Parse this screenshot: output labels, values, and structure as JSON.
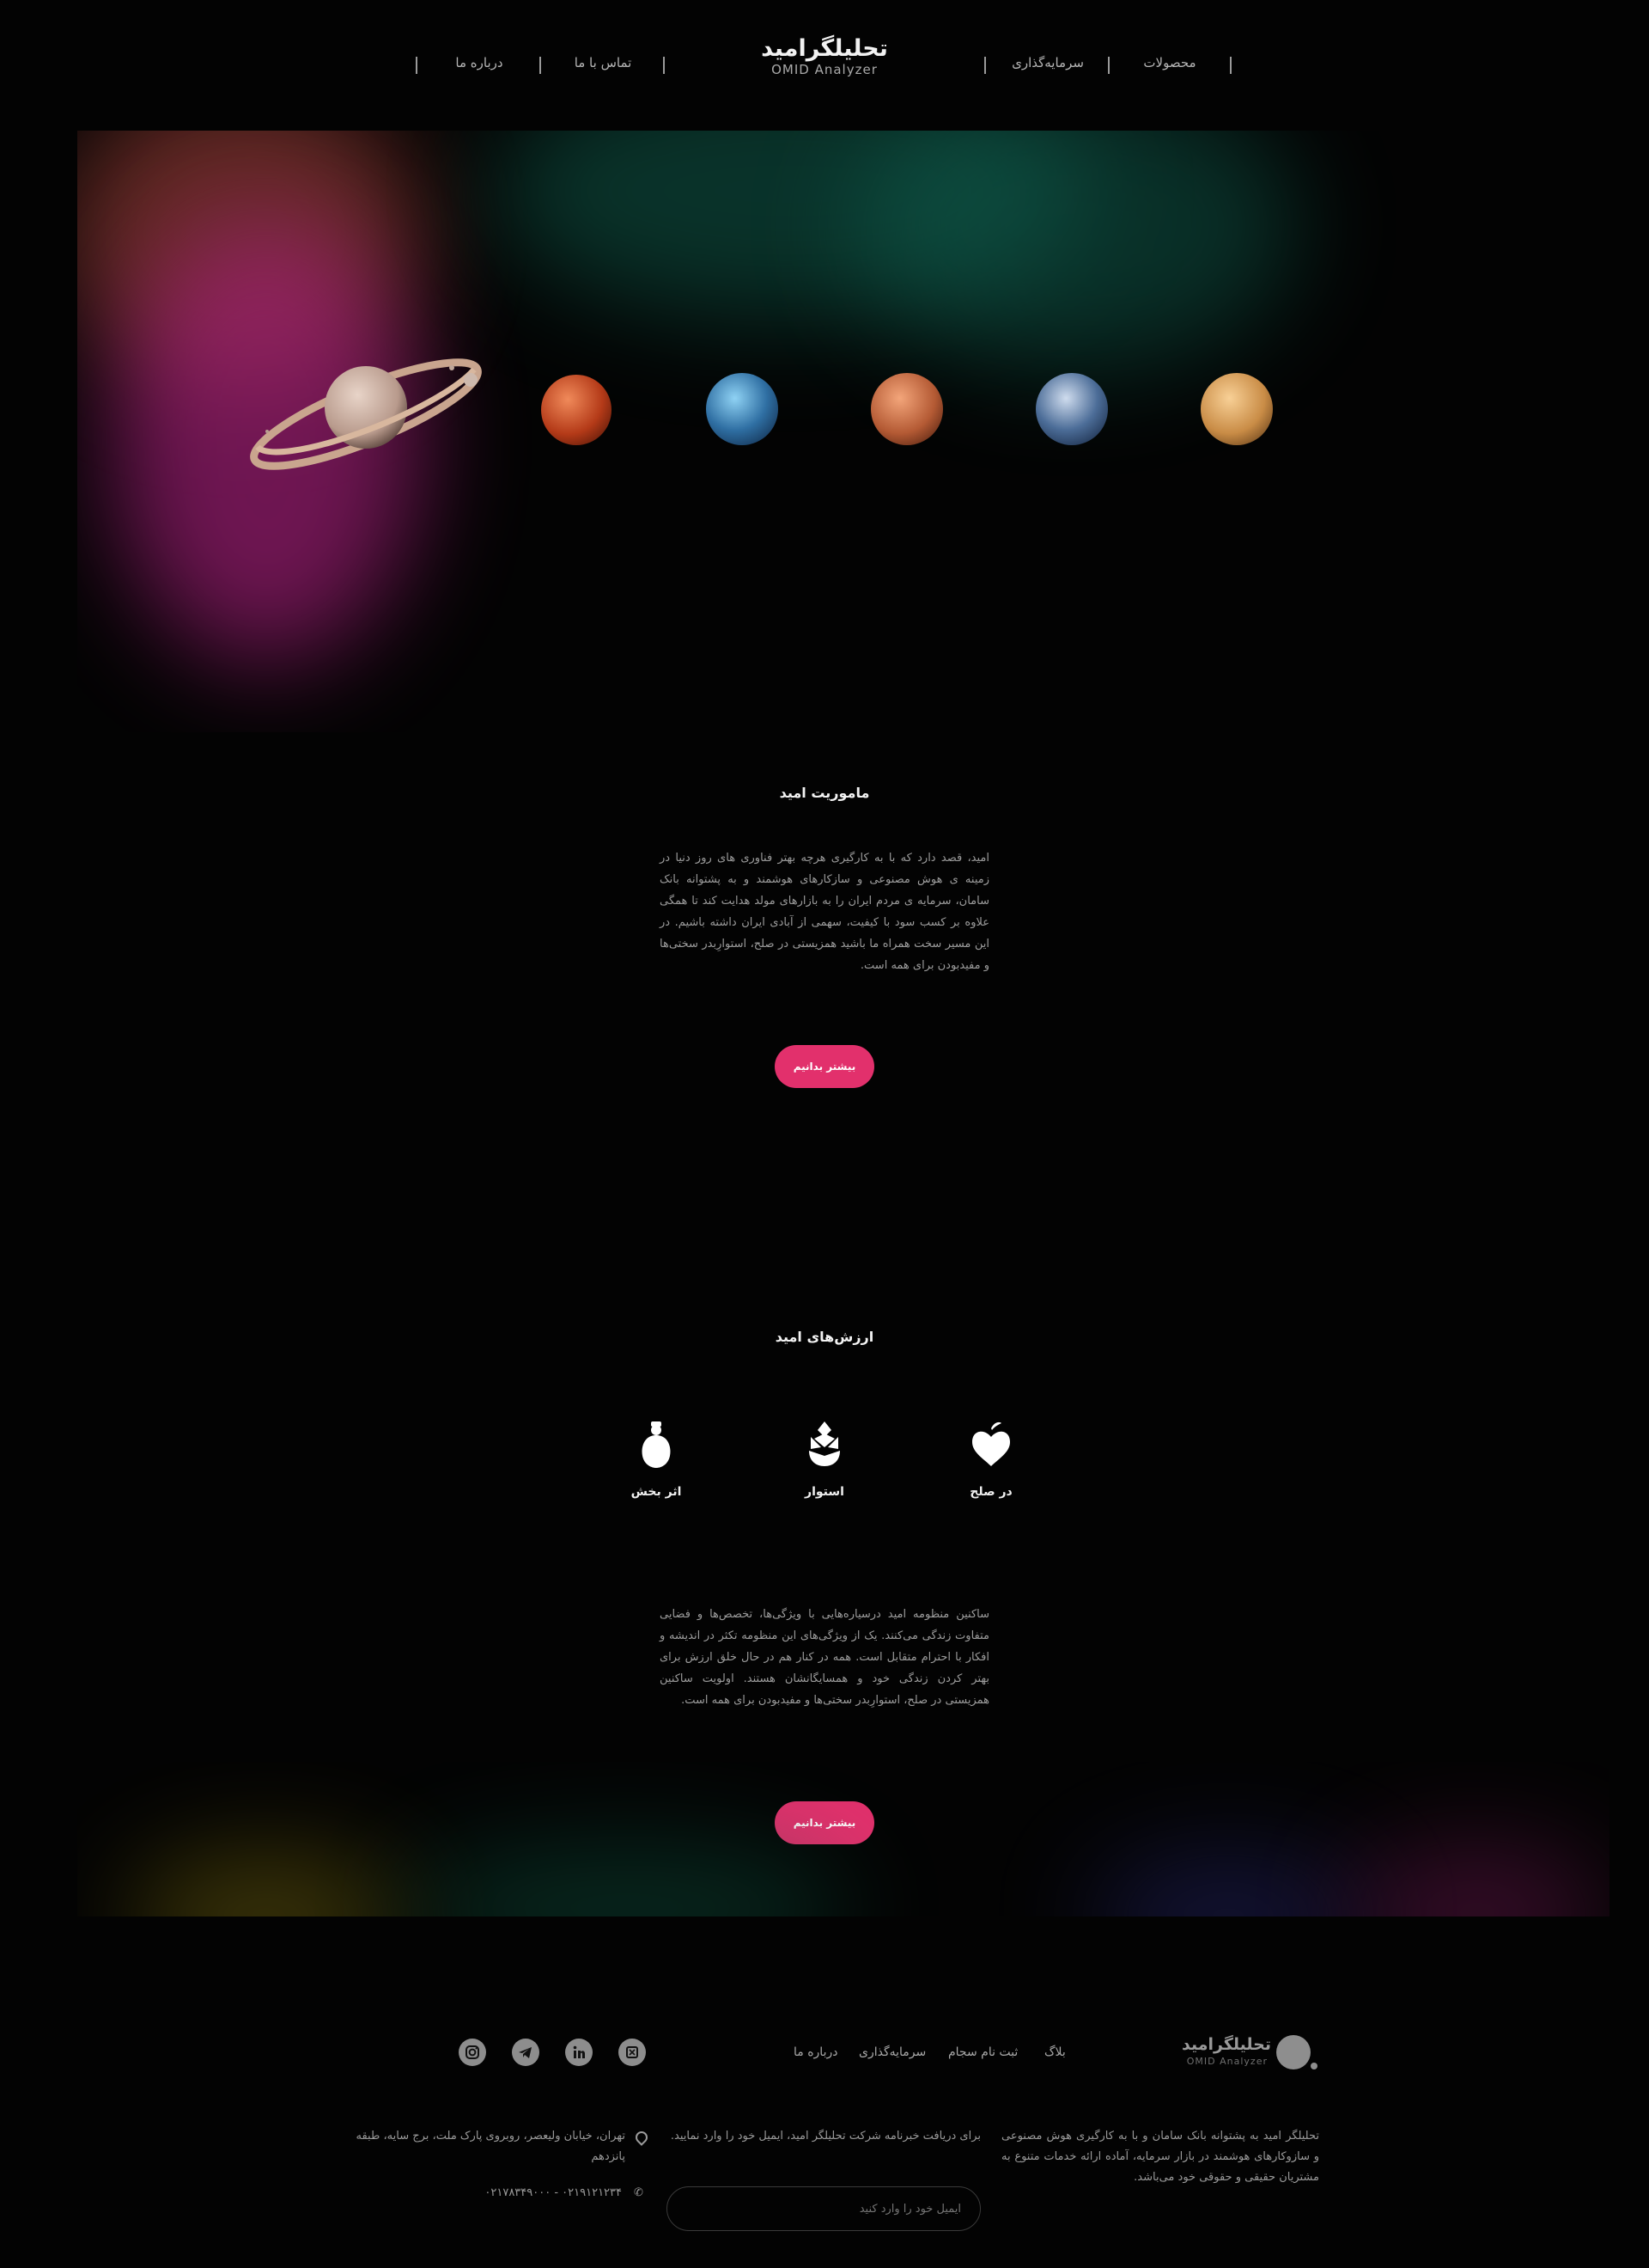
{
  "header": {
    "logo_fa": "تحلیلگرامید",
    "logo_en": "OMID Analyzer",
    "nav_right": [
      "محصولات",
      "سرمایه‌گذاری"
    ],
    "nav_left": [
      "تماس با ما",
      "درباره ما"
    ]
  },
  "mission": {
    "title": "ماموریت امید",
    "body": "امید، قصد دارد که با به کارگیری هرچه بهتر فناوری های روز دنیا در زمینه ی هوش مصنوعی و سازکارهای هوشمند و به پشتوانه بانک سامان، سرمایه ی مردم ایران را به بازارهای مولد هدایت کند تا همگی علاوه بر کسب سود با کیفیت، سهمی از آبادی ایران داشته باشیم. در این مسیر سخت همراه ما باشید همزیستی در صلح، استوارِبدر سختی‌ها و مفیدبودن برای همه است.",
    "cta": "بیشتر بدانیم"
  },
  "values": {
    "title": "ارزش‌های امید",
    "items": [
      {
        "label": "در صلح",
        "icon": "apple-heart-icon"
      },
      {
        "label": "استوار",
        "icon": "pinecone-icon"
      },
      {
        "label": "اثر بخش",
        "icon": "seed-icon"
      }
    ],
    "body": "ساکنین منظومه امید درسیاره‌هایی با ویژگی‌ها، تخصص‌ها و فضایی متفاوت زندگی می‌کنند. یک از ویژگی‌های این منظومه تکثر در اندیشه و افکار با احترام متقابل است. همه در کنار هم در حال خلق ارزش برای بهتر کردن زندگی خود و همسایگانشان هستند. اولویت ساکنین همزیستی در صلح، استوارِبدر سختی‌ها و مفیدبودن برای همه است.",
    "cta": "بیشتر بدانیم"
  },
  "footer": {
    "logo_fa": "تحلیلگرامید",
    "logo_en": "OMID Analyzer",
    "links": [
      "بلاگ",
      "ثبت نام سجام",
      "سرمایه‌گذاری",
      "درباره ما"
    ],
    "socials": [
      "instagram-icon",
      "telegram-icon",
      "linkedin-icon",
      "app-icon"
    ],
    "about": "تحلیلگر امید به پشتوانه بانک سامان و با به کارگیری هوش مصنوعی و سازوکارهای هوشمند در بازار سرمایه، آماده ارائه خدمات متنوع به مشتریان حقیقی و حقوقی خود می‌باشد.",
    "newsletter": "برای دریافت خبرنامه شرکت تحلیلگر امید، ایمیل خود را وارد نمایید.",
    "email_placeholder": "ایمیل خود را وارد کنید",
    "address": "تهران، خیابان ولیعصر، روبروی پارک ملت، برج سایه، طبقه پانزدهم",
    "phone": "۰۲۱۹۱۲۱۲۳۴ - ۰۲۱۷۸۳۴۹۰۰۰"
  }
}
